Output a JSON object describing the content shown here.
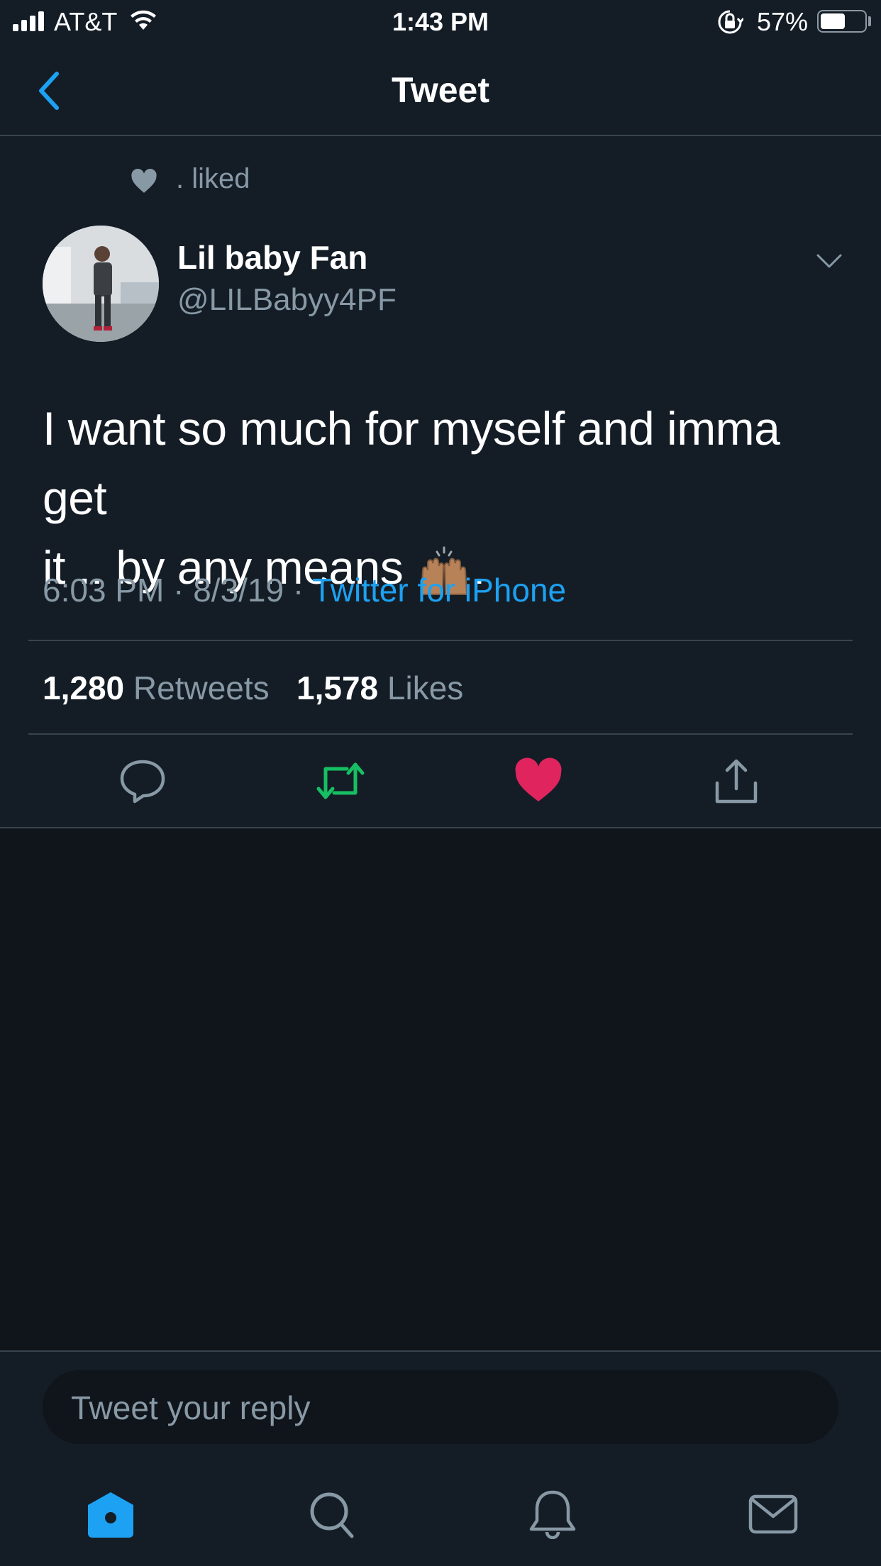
{
  "status_bar": {
    "carrier": "AT&T",
    "time": "1:43 PM",
    "battery_percent": "57%",
    "battery_level": 0.57
  },
  "nav": {
    "title": "Tweet"
  },
  "tweet": {
    "social_context": ". liked",
    "author_name": "Lil baby Fan",
    "author_handle": "@LILBabyy4PF",
    "text_line1": "I want so much for myself and imma get",
    "text_line2": "it .. by any means",
    "text_end": ".",
    "emoji": "raising-hands-emoji",
    "time": "6:03 PM",
    "date": "8/3/19",
    "separator": "·",
    "source": "Twitter for iPhone",
    "retweets_count": "1,280",
    "retweets_label": "Retweets",
    "likes_count": "1,578",
    "likes_label": "Likes"
  },
  "actions": [
    "reply-icon",
    "retweet-icon",
    "like-icon",
    "share-icon"
  ],
  "colors": {
    "background": "#141d26",
    "empty_area": "#10141b",
    "accent": "#1da1f2",
    "retweet": "#17bf63",
    "like": "#e0245e",
    "secondary_text": "#8899a6"
  },
  "reply": {
    "placeholder": "Tweet your reply"
  },
  "tabbar": [
    "home-icon",
    "search-icon",
    "notifications-icon",
    "messages-icon"
  ]
}
